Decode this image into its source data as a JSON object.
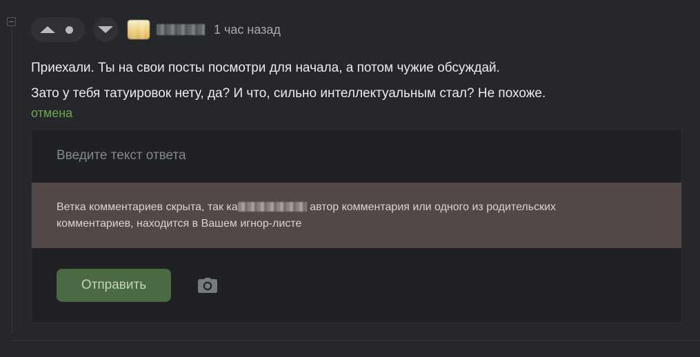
{
  "comment": {
    "timestamp": "1 час назад",
    "lines": [
      "Приехали. Ты на свои посты посмотри для начала, а потом чужие обсуждай.",
      "Зато у тебя татуировок нету, да? И что, сильно интеллектуальным стал? Не похоже."
    ],
    "cancel_label": "отмена"
  },
  "reply": {
    "placeholder": "Введите текст ответа",
    "notice_before": "Ветка комментариев скрыта, так ка",
    "notice_after": " автор комментария или одного из родительских",
    "notice_line2": "комментариев, находится в Вашем игнор-листе",
    "send_label": "Отправить"
  },
  "icons": {
    "vote_up": "arrow-up-icon",
    "vote_down": "arrow-down-icon",
    "rating": "dot-icon",
    "attach": "camera-icon",
    "collapse": "minus-square-icon"
  },
  "colors": {
    "background": "#25272b",
    "accent_green": "#6aa84f",
    "send_button": "#4a6a44",
    "notice_bg": "#524845"
  }
}
